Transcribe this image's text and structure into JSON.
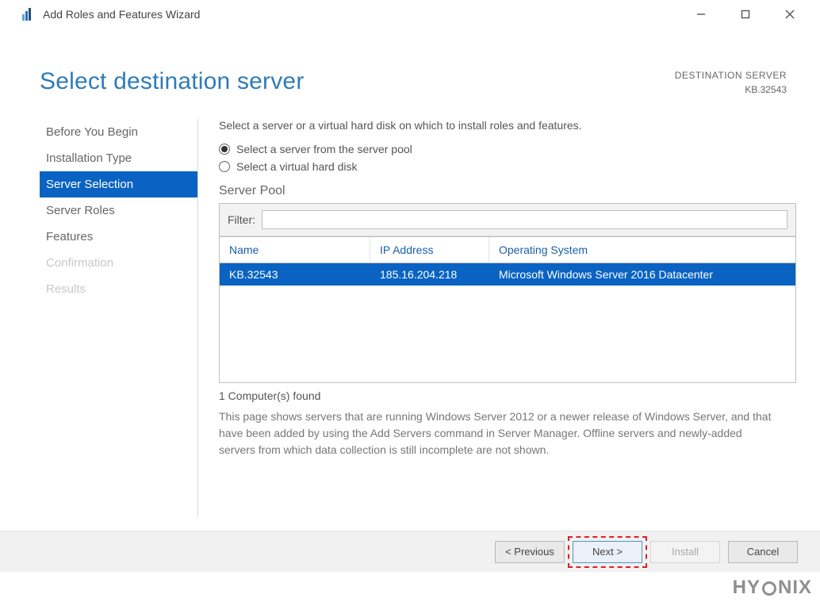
{
  "window": {
    "title": "Add Roles and Features Wizard"
  },
  "header": {
    "page_title": "Select destination server",
    "dest_label": "DESTINATION SERVER",
    "dest_name": "KB.32543"
  },
  "sidebar": {
    "items": [
      {
        "label": "Before You Begin",
        "state": "normal"
      },
      {
        "label": "Installation Type",
        "state": "normal"
      },
      {
        "label": "Server Selection",
        "state": "active"
      },
      {
        "label": "Server Roles",
        "state": "normal"
      },
      {
        "label": "Features",
        "state": "normal"
      },
      {
        "label": "Confirmation",
        "state": "disabled"
      },
      {
        "label": "Results",
        "state": "disabled"
      }
    ]
  },
  "content": {
    "intro": "Select a server or a virtual hard disk on which to install roles and features.",
    "radio1": "Select a server from the server pool",
    "radio2": "Select a virtual hard disk",
    "section": "Server Pool",
    "filter_label": "Filter:",
    "filter_value": "",
    "columns": {
      "name": "Name",
      "ip": "IP Address",
      "os": "Operating System"
    },
    "rows": [
      {
        "name": "KB.32543",
        "ip": "185.16.204.218",
        "os": "Microsoft Windows Server 2016 Datacenter"
      }
    ],
    "found": "1 Computer(s) found",
    "footnote": "This page shows servers that are running Windows Server 2012 or a newer release of Windows Server, and that have been added by using the Add Servers command in Server Manager. Offline servers and newly-added servers from which data collection is still incomplete are not shown."
  },
  "buttons": {
    "previous": "< Previous",
    "next": "Next >",
    "install": "Install",
    "cancel": "Cancel"
  },
  "watermark": {
    "pre": "HY",
    "post": "NIX"
  }
}
